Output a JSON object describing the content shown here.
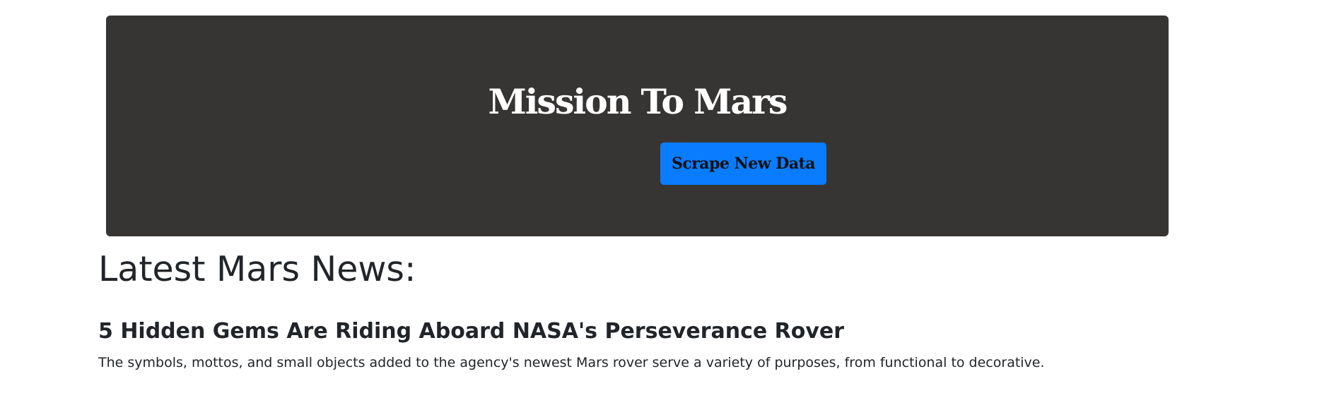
{
  "jumbotron": {
    "title": "Mission To Mars",
    "button_label": "Scrape New Data",
    "background_color": "#373534",
    "button_color": "#0a7cff"
  },
  "news": {
    "heading": "Latest Mars News:",
    "title": "5 Hidden Gems Are Riding Aboard NASA's Perseverance Rover",
    "teaser": "The symbols, mottos, and small objects added to the agency's newest Mars rover serve a variety of purposes, from functional to decorative."
  }
}
